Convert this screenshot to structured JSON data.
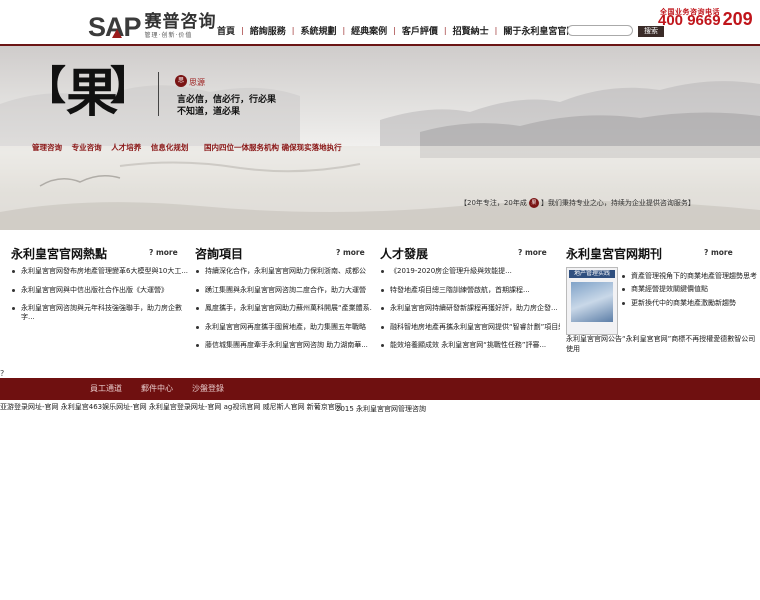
{
  "marks": {
    "top": "?",
    "bottom": "?"
  },
  "logo": {
    "sap": "SAP",
    "cn": "赛普咨询",
    "sub": "管理·创新·价值"
  },
  "nav": [
    "首頁",
    "諮詢服務",
    "系統規劃",
    "經典案例",
    "客戶評價",
    "招賢納士",
    "關于永利皇宮官网"
  ],
  "nav_separator": "|",
  "search": {
    "placeholder": "",
    "button": "搜索"
  },
  "hotline": {
    "label": "全国业务咨询电话",
    "number_main": "400 9669",
    "number_tail": "209"
  },
  "banner": {
    "bracket_left": "【",
    "big_char": "果",
    "bracket_right": "】",
    "seal": "思",
    "motto_label": "思源",
    "motto_line1": "言必信，信必行，行必果",
    "motto_line2": "不知道，道必果",
    "links": [
      "管理咨询",
      "专业咨询",
      "人才培养",
      "信息化规划",
      "国内四位一体服务机构 确保现实落地执行"
    ],
    "tagline_pre": "【20年专注，20年成",
    "tagline_seal": "果",
    "tagline_post": "】我们秉持专业之心，持续为企业提供咨询服务】"
  },
  "columns": {
    "col1": {
      "title": "永利皇宮官网熱點",
      "more": "? more",
      "items": [
        "永利皇宮官网發布房地產管理變革6大模型與10大工...",
        "永利皇宮官网與中信出版社合作出版《大運營》",
        "永利皇宮官网咨詢與元年科技強強聯手，助力房企數字..."
      ]
    },
    "col2": {
      "title": "咨詢項目",
      "more": "? more",
      "items": [
        "持續深化合作，永利皇宮官网助力保利浙南、成都公",
        "踴江集團與永利皇宮官网咨詢二度合作，助力大運營",
        "鳳度攜手，永利皇宮官网助力蘇州萬科開展“產業體系...",
        "永利皇宮官网再度攜手國貿地產，助力集團五年戰略",
        "藤信城集團再度牽手永利皇宮官网咨詢 助力湖南華..."
      ]
    },
    "col3": {
      "title": "人才發展",
      "more": "? more",
      "items": [
        "《2019-2020房企管理升級與效能提...",
        "特發地產項目總三階訓練營啟航，首期課程...",
        "永利皇宮官网持續研發新課程再獲好評，助力房企發...",
        "融科智地房地產再攜永利皇宮官网提供“智睿計劃”項目總、專...",
        "能效培養顯成效 永利皇宮官网“挑戰性任務”評審..."
      ]
    },
    "col4": {
      "title": "永利皇宮官网期刊",
      "more": "? more",
      "magazine_title": "地产管理实践",
      "items": [
        "資產管理視角下的商業地產管理趨勢思考",
        "商業經營提效關鍵價值點",
        "更新換代中的商業地產激勵新趨勢"
      ],
      "notice": "永利皇宮官网公告“永利皇宮官网”商標不再授權愛德數智公司使用"
    }
  },
  "footer": {
    "links": [
      "員工通道",
      "郵件中心",
      "沙盤登錄"
    ],
    "friend_links": "亚游登录网址-官网 永利皇宫463娱乐网址-官网 永利皇宫登录网址-官网 ag视讯官网 威尼斯人官网 新葡京官网",
    "copyright": "2015 永利皇宮官网管理咨詢"
  },
  "colors": {
    "brand": "#6f1010",
    "accent": "#c0151b",
    "nav_sep": "#9a2b2b"
  }
}
